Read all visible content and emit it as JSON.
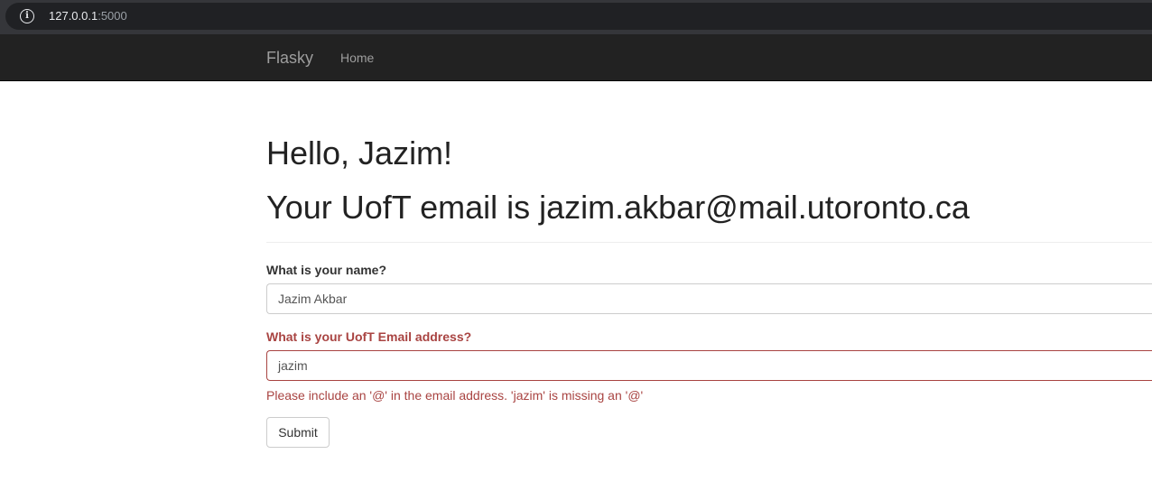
{
  "browser": {
    "url_host": "127.0.0.1",
    "url_port": ":5000"
  },
  "navbar": {
    "brand": "Flasky",
    "home_label": "Home"
  },
  "page": {
    "greeting": "Hello, Jazim!",
    "email_heading": "Your UofT email is jazim.akbar@mail.utoronto.ca"
  },
  "form": {
    "name_label": "What is your name?",
    "name_value": "Jazim Akbar",
    "email_label": "What is your UofT Email address?",
    "email_value": "jazim",
    "email_error": "Please include an '@' in the email address. 'jazim' is missing an '@'",
    "submit_label": "Submit"
  },
  "colors": {
    "navbar_bg": "#222222",
    "error": "#a94442"
  }
}
